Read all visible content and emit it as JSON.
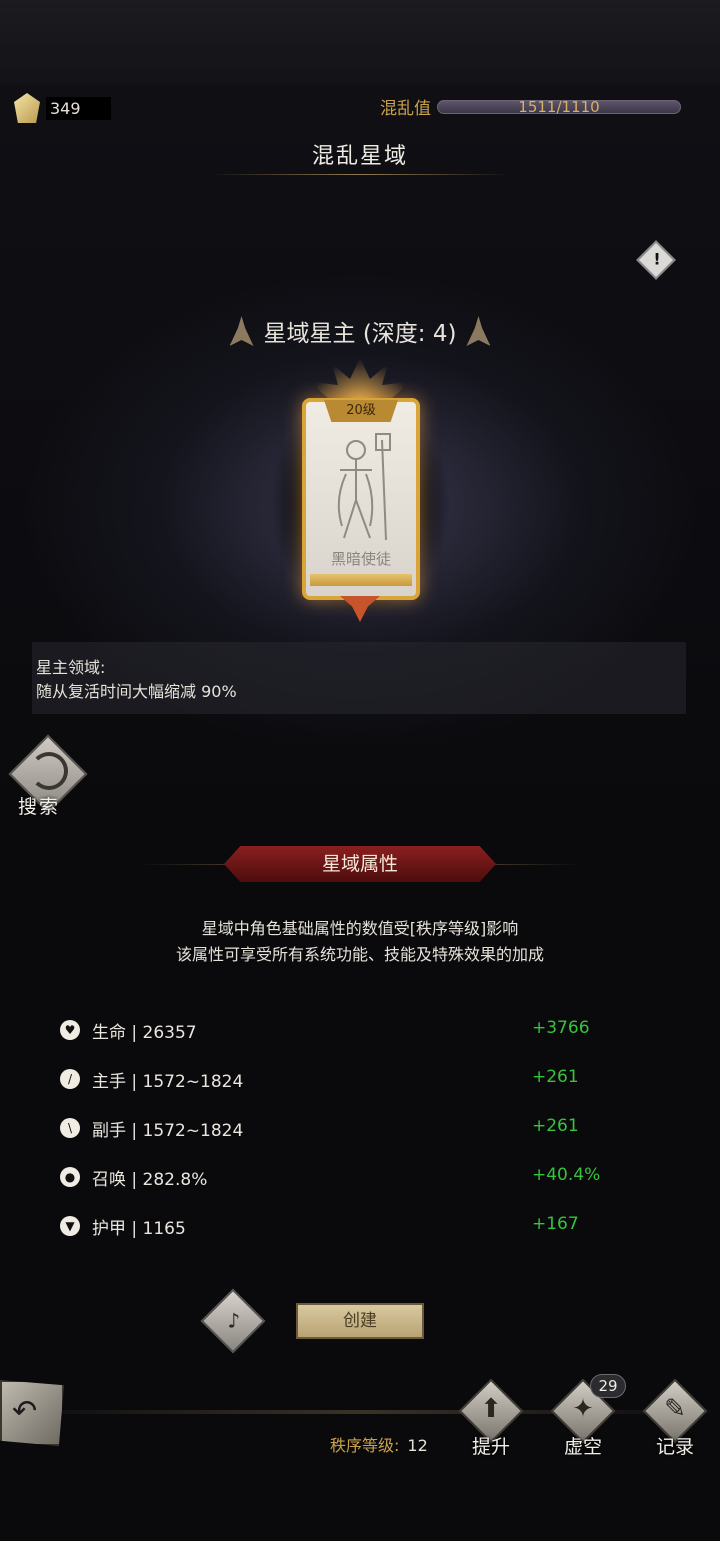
{
  "header": {
    "currency_amount": "349",
    "chaos_label": "混乱值",
    "chaos_value": "1511/1110",
    "title": "混乱星域"
  },
  "lord": {
    "heading": "星域星主 (深度: 4)",
    "card_level": "20级",
    "card_name": "黑暗使徒"
  },
  "domain": {
    "title": "星主领域:",
    "effect": "随从复活时间大幅缩减 90%"
  },
  "search_label": "搜索",
  "section": {
    "title": "星域属性",
    "desc_line1": "星域中角色基础属性的数值受[秩序等级]影响",
    "desc_line2": "该属性可享受所有系统功能、技能及特殊效果的加成"
  },
  "stats": [
    {
      "icon": "heart-icon",
      "label": "生命 | 26357",
      "bonus": "+3766"
    },
    {
      "icon": "sword-icon",
      "label": "主手 | 1572~1824",
      "bonus": "+261"
    },
    {
      "icon": "shield-icon",
      "label": "副手 | 1572~1824",
      "bonus": "+261"
    },
    {
      "icon": "summon-icon",
      "label": "召唤 | 282.8%",
      "bonus": "+40.4%"
    },
    {
      "icon": "armor-icon",
      "label": "护甲 | 1165",
      "bonus": "+167"
    }
  ],
  "actions": {
    "create_label": "创建"
  },
  "footer": {
    "order_label": "秩序等级:",
    "order_value": "12",
    "upgrade_label": "提升",
    "void_label": "虚空",
    "void_badge": "29",
    "record_label": "记录"
  },
  "colors": {
    "accent_gold": "#c9a24a",
    "bonus_green": "#35c43a",
    "section_red": "#8a1f1f"
  }
}
